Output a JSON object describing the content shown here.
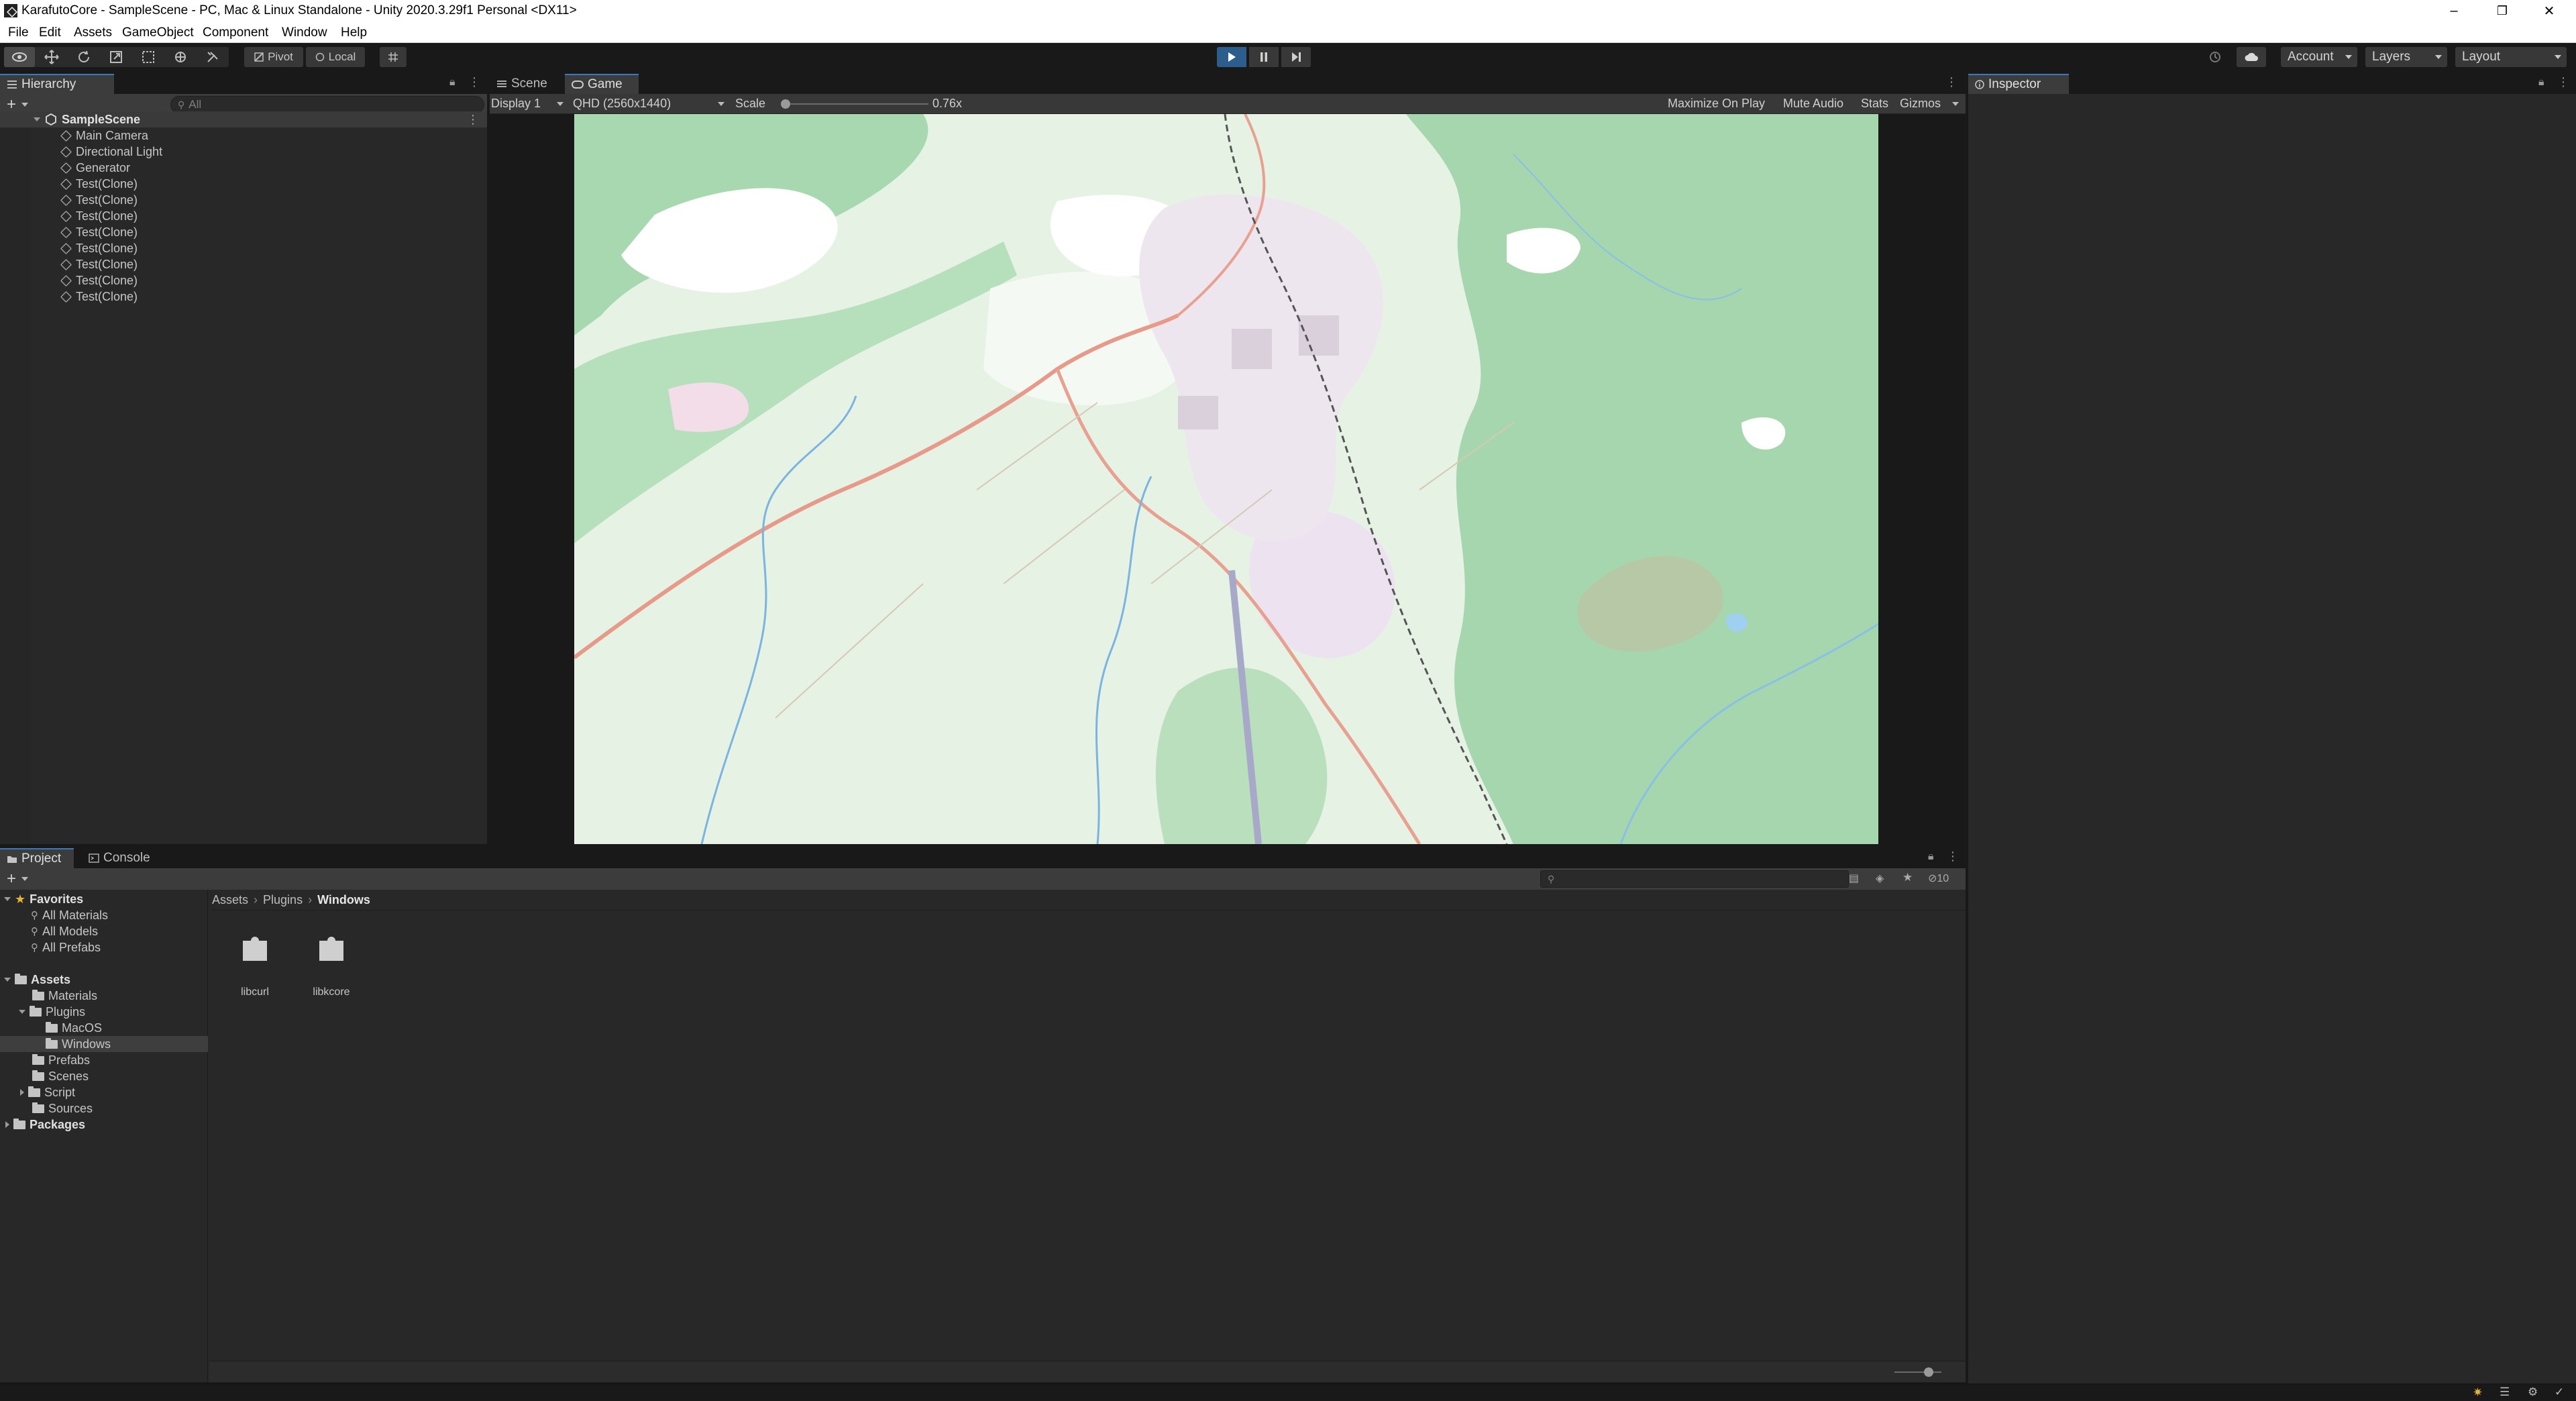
{
  "window": {
    "title": "KarafutoCore - SampleScene - PC, Mac & Linux Standalone - Unity 2020.3.29f1 Personal <DX11>",
    "minimize": "–",
    "maximize": "❐",
    "close": "✕"
  },
  "menu": [
    "File",
    "Edit",
    "Assets",
    "GameObject",
    "Component",
    "Window",
    "Help"
  ],
  "toolbar": {
    "pivot_label": "Pivot",
    "local_label": "Local",
    "account_label": "Account",
    "layers_label": "Layers",
    "layout_label": "Layout",
    "play_state": "playing"
  },
  "hierarchy": {
    "tab_label": "Hierarchy",
    "search_placeholder": "All",
    "scene_name": "SampleScene",
    "items": [
      "Main Camera",
      "Directional Light",
      "Generator",
      "Test(Clone)",
      "Test(Clone)",
      "Test(Clone)",
      "Test(Clone)",
      "Test(Clone)",
      "Test(Clone)",
      "Test(Clone)",
      "Test(Clone)"
    ]
  },
  "game": {
    "scene_tab": "Scene",
    "game_tab": "Game",
    "display": "Display 1",
    "resolution": "QHD (2560x1440)",
    "scale_label": "Scale",
    "scale_value": "0.76x",
    "scale_fraction": 0.0,
    "maximize_on_play": "Maximize On Play",
    "mute_audio": "Mute Audio",
    "stats": "Stats",
    "gizmos": "Gizmos"
  },
  "inspector": {
    "tab_label": "Inspector"
  },
  "project": {
    "project_tab": "Project",
    "console_tab": "Console",
    "hidden_count": "10",
    "breadcrumb": [
      "Assets",
      "Plugins",
      "Windows"
    ],
    "favorites_label": "Favorites",
    "favorites": [
      "All Materials",
      "All Models",
      "All Prefabs"
    ],
    "assets_label": "Assets",
    "folders": [
      "Materials",
      "Plugins",
      "MacOS",
      "Windows",
      "Prefabs",
      "Scenes",
      "Script",
      "Sources"
    ],
    "packages_label": "Packages",
    "files": [
      "libcurl",
      "libkcore"
    ]
  },
  "colors": {
    "play_accent": "#2d5d8c",
    "tab_accent": "#3a79bb",
    "map_forest": "#a6d9b1",
    "map_field": "#e6f4e6"
  }
}
